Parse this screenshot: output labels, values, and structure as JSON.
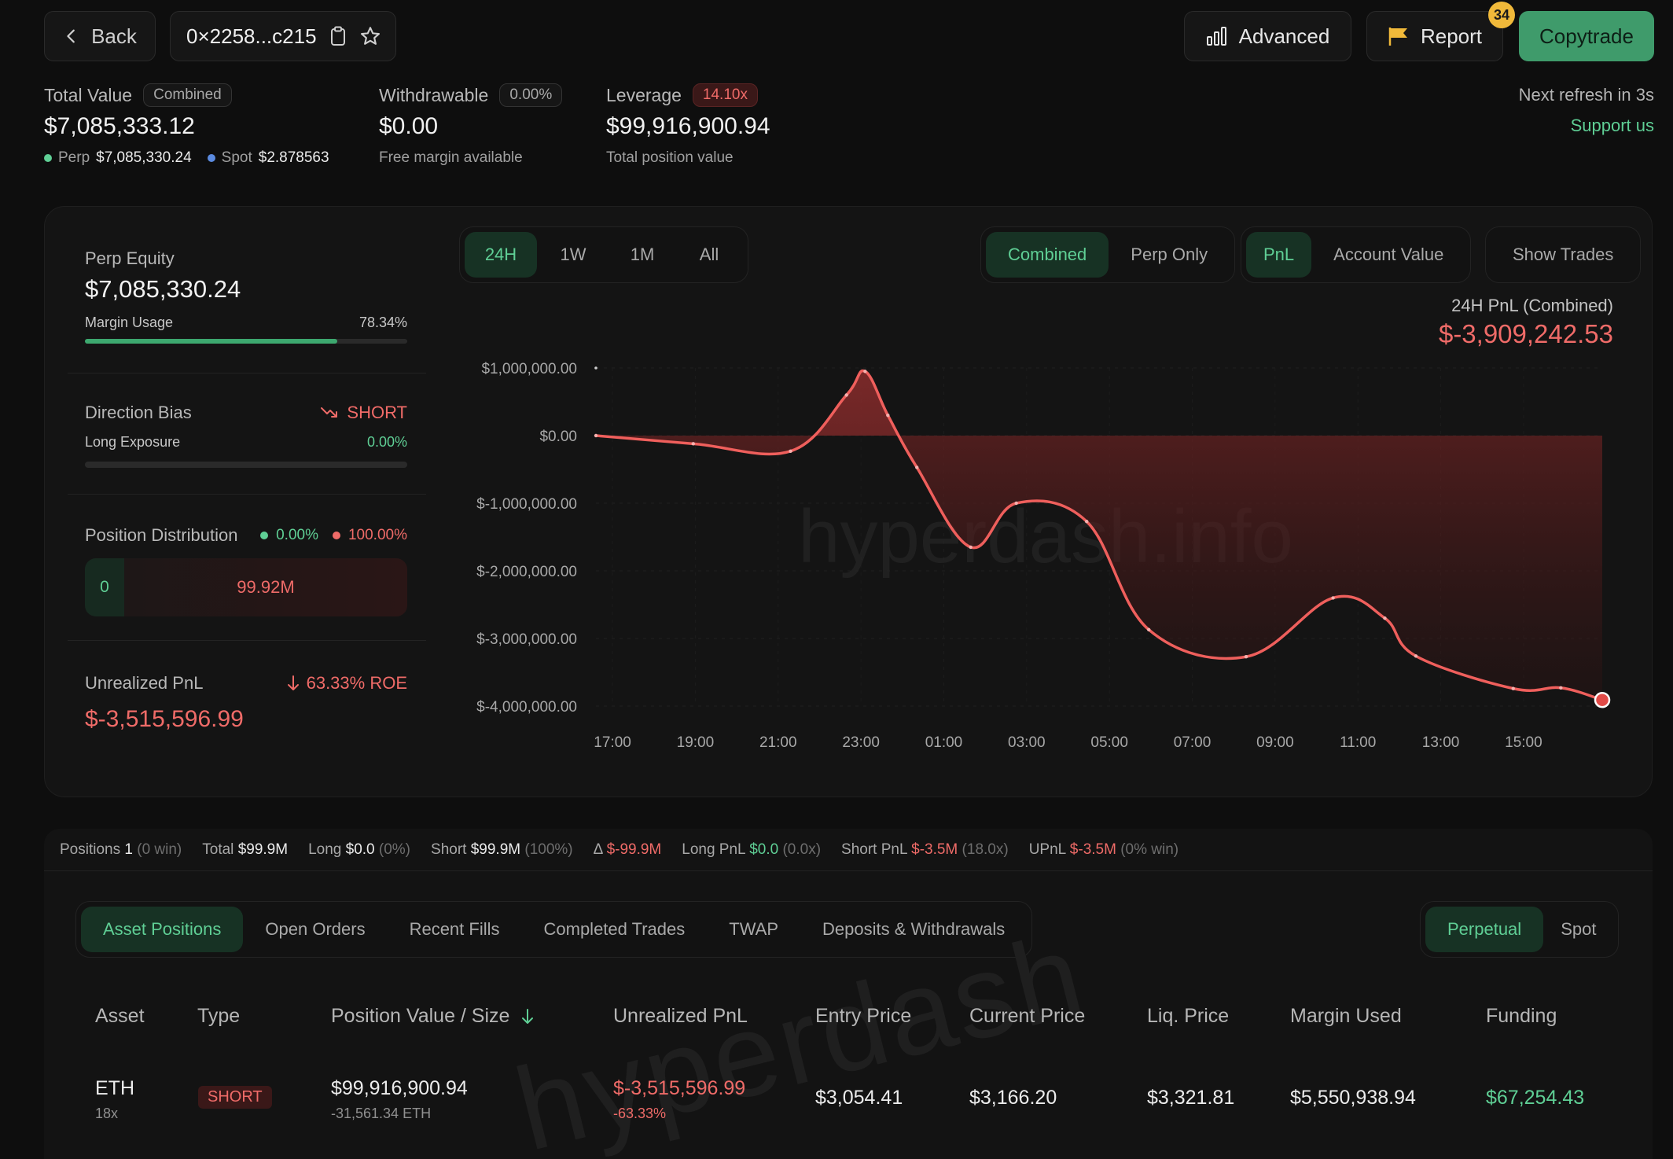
{
  "header": {
    "back_label": "Back",
    "address": "0×2258...c215",
    "advanced_label": "Advanced",
    "report_label": "Report",
    "report_badge": "34",
    "copytrade_label": "Copytrade",
    "refresh_text": "Next refresh in 3s",
    "support_label": "Support us"
  },
  "stats": {
    "total_value": {
      "label": "Total Value",
      "chip": "Combined",
      "value": "$7,085,333.12",
      "perp_label": "Perp",
      "perp_value": "$7,085,330.24",
      "spot_label": "Spot",
      "spot_value": "$2.878563"
    },
    "withdrawable": {
      "label": "Withdrawable",
      "chip": "0.00%",
      "value": "$0.00",
      "sub": "Free margin available"
    },
    "leverage": {
      "label": "Leverage",
      "chip": "14.10x",
      "value": "$99,916,900.94",
      "sub": "Total position value"
    }
  },
  "left_panel": {
    "perp_equity_label": "Perp Equity",
    "perp_equity_value": "$7,085,330.24",
    "margin_usage_label": "Margin Usage",
    "margin_usage_value": "78.34%",
    "margin_usage_fraction": 0.7834,
    "direction_bias_label": "Direction Bias",
    "direction_bias_value": "SHORT",
    "long_exposure_label": "Long Exposure",
    "long_exposure_value": "0.00%",
    "position_distribution_label": "Position Distribution",
    "dist_long_pct": "0.00%",
    "dist_short_pct": "100.00%",
    "dist_long_value": "0",
    "dist_short_value": "99.92M",
    "unrealized_pnl_label": "Unrealized PnL",
    "roe_value": "63.33% ROE",
    "unrealized_pnl_value": "$-3,515,596.99"
  },
  "chart_controls": {
    "ranges": [
      "24H",
      "1W",
      "1M",
      "All"
    ],
    "active_range": "24H",
    "modes": [
      "Combined",
      "Perp Only"
    ],
    "active_mode": "Combined",
    "metrics": [
      "PnL",
      "Account Value"
    ],
    "active_metric": "PnL",
    "show_trades_label": "Show Trades",
    "summary_label": "24H PnL (Combined)",
    "summary_value": "$-3,909,242.53",
    "watermark": "hyperdash.info"
  },
  "chart_data": {
    "type": "area",
    "title": "",
    "xlabel": "",
    "ylabel": "",
    "ylim": [
      -4000000,
      1000000
    ],
    "y_ticks": [
      1000000,
      0,
      -1000000,
      -2000000,
      -3000000,
      -4000000
    ],
    "y_tick_labels": [
      "$1,000,000.00",
      "$0.00",
      "$-1,000,000.00",
      "$-2,000,000.00",
      "$-3,000,000.00",
      "$-4,000,000.00"
    ],
    "x_tick_labels": [
      "17:00",
      "19:00",
      "21:00",
      "23:00",
      "01:00",
      "03:00",
      "05:00",
      "07:00",
      "09:00",
      "11:00",
      "13:00",
      "15:00"
    ],
    "x_range_hours": [
      16.6,
      40.9
    ],
    "series": [
      {
        "x": [
          16.6,
          18.95,
          21.3,
          22.65,
          23.1,
          23.65,
          24.35,
          25.65,
          26.75,
          28.45,
          29.95,
          32.3,
          34.4,
          35.65,
          36.4,
          38.75,
          39.9,
          40.9
        ],
        "values": [
          0,
          -120000,
          -230000,
          600000,
          950000,
          300000,
          -470000,
          -1650000,
          -1000000,
          -1270000,
          -2870000,
          -3270000,
          -2400000,
          -2700000,
          -3260000,
          -3740000,
          -3730000,
          -3909242
        ]
      }
    ],
    "grid": true
  },
  "summary_bar": {
    "positions_label": "Positions",
    "positions_value": "1",
    "positions_paren": "(0 win)",
    "total_label": "Total",
    "total_value": "$99.9M",
    "long_label": "Long",
    "long_value": "$0.0",
    "long_paren": "(0%)",
    "short_label": "Short",
    "short_value": "$99.9M",
    "short_paren": "(100%)",
    "delta_label": "Δ",
    "delta_value": "$-99.9M",
    "long_pnl_label": "Long PnL",
    "long_pnl_value": "$0.0",
    "long_pnl_paren": "(0.0x)",
    "short_pnl_label": "Short PnL",
    "short_pnl_value": "$-3.5M",
    "short_pnl_paren": "(18.0x)",
    "upnl_label": "UPnL",
    "upnl_value": "$-3.5M",
    "upnl_paren": "(0% win)"
  },
  "tabs": {
    "items": [
      "Asset Positions",
      "Open Orders",
      "Recent Fills",
      "Completed Trades",
      "TWAP",
      "Deposits & Withdrawals"
    ],
    "active": "Asset Positions",
    "market_types": [
      "Perpetual",
      "Spot"
    ],
    "active_market": "Perpetual"
  },
  "table": {
    "headers": [
      "Asset",
      "Type",
      "Position Value / Size",
      "Unrealized PnL",
      "Entry Price",
      "Current Price",
      "Liq. Price",
      "Margin Used",
      "Funding"
    ],
    "rows": [
      {
        "asset": "ETH",
        "leverage": "18x",
        "type": "SHORT",
        "position_value": "$99,916,900.94",
        "size": "-31,561.34 ETH",
        "unrealized_pnl": "$-3,515,596.99",
        "pnl_pct": "-63.33%",
        "entry_price": "$3,054.41",
        "current_price": "$3,166.20",
        "liq_price": "$3,321.81",
        "margin_used": "$5,550,938.94",
        "funding": "$67,254.43"
      }
    ],
    "watermark": "hyperdash"
  },
  "colors": {
    "accent_green": "#5fcf95",
    "accent_red": "#ef6b68",
    "copytrade": "#3f9b6b",
    "badge": "#f0b93a"
  }
}
